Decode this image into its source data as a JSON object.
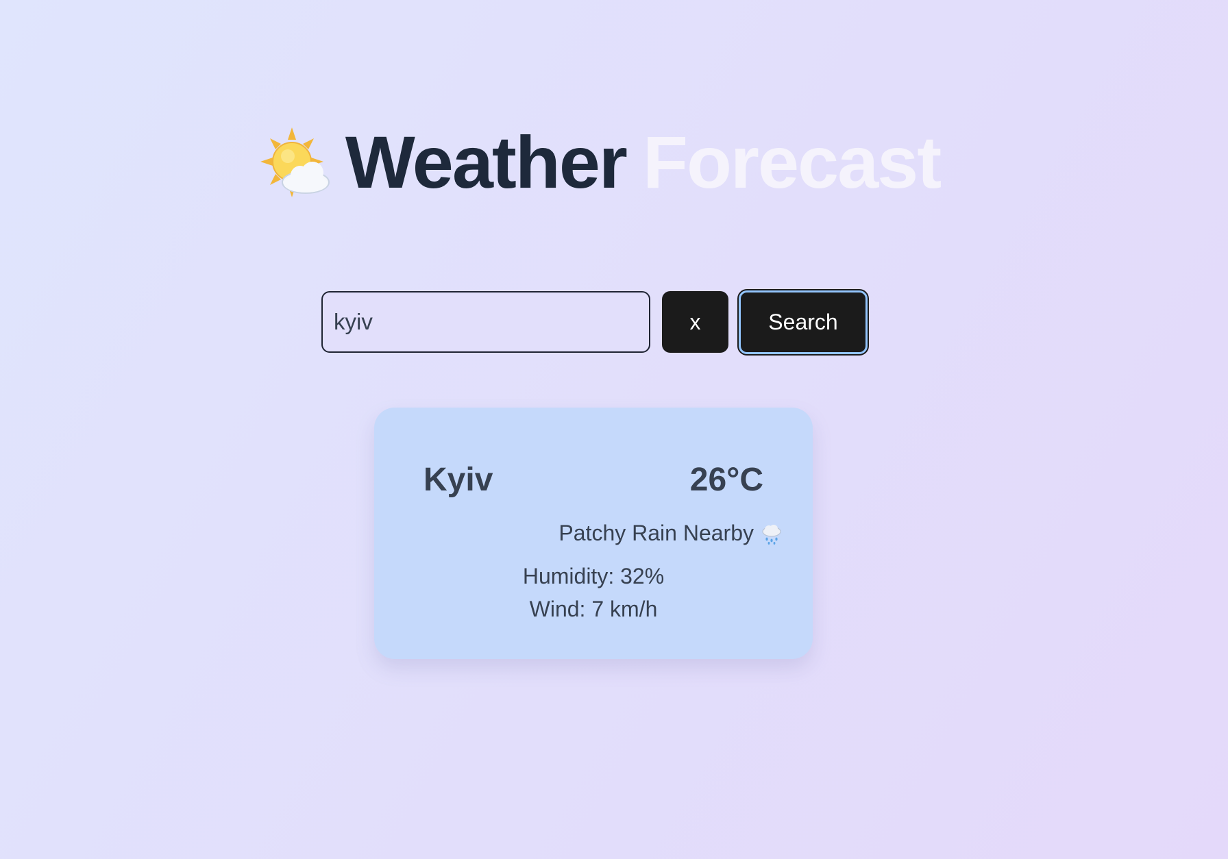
{
  "header": {
    "icon": "sun-behind-cloud-icon",
    "title_part1": "Weather",
    "title_part2": "Forecast"
  },
  "search": {
    "value": "kyiv",
    "clear_label": "x",
    "search_label": "Search"
  },
  "weather": {
    "city": "Kyiv",
    "temperature": "26°C",
    "condition": "Patchy Rain Nearby",
    "condition_icon": "cloud-with-rain-icon",
    "humidity": "Humidity: 32%",
    "wind": "Wind: 7 km/h"
  },
  "colors": {
    "background_start": "#e0e5fd",
    "background_end": "#e4d9fa",
    "title_dark": "#1e293b",
    "title_light": "#f5f3fc",
    "button_bg": "#1b1b1b",
    "focus_ring": "#93c5fd",
    "card_bg": "#c5d9fb",
    "card_text": "#374151"
  }
}
